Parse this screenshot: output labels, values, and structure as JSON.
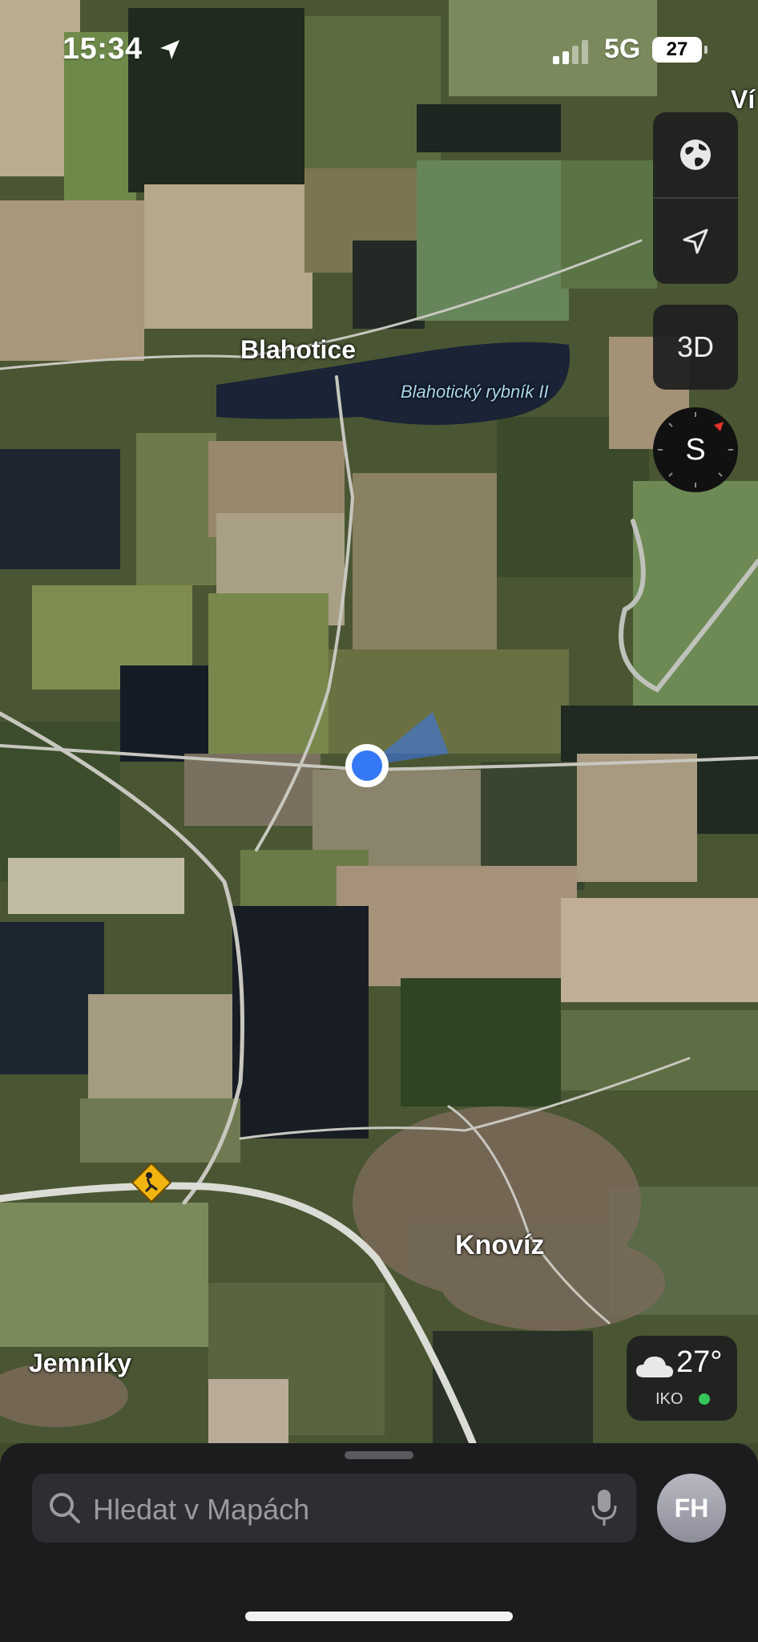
{
  "status_bar": {
    "time": "15:34",
    "network": "5G",
    "battery": "27",
    "icons": [
      "location-arrow-icon",
      "signal-icon",
      "battery-icon"
    ]
  },
  "map": {
    "style": "satellite",
    "labels": {
      "village_top": "Blahotice",
      "lake": "Blahotický rybník II",
      "village_center": "Knovíz",
      "village_left": "Jemníky",
      "edge_cut": "Ví"
    },
    "icons": [
      "construction-warning-icon",
      "user-location-dot"
    ]
  },
  "controls": {
    "globe_icon": "globe-icon",
    "locate_icon": "location-arrow-icon",
    "three_d_label": "3D",
    "compass_letter": "S"
  },
  "weather": {
    "temperature": "27°",
    "air_quality_label": "IKO",
    "icon": "cloud-icon",
    "status_color": "#34c759"
  },
  "search": {
    "placeholder": "Hledat v Mapách",
    "icons": [
      "search-icon",
      "microphone-icon"
    ]
  },
  "profile": {
    "initials": "FH"
  },
  "colors": {
    "panel": "#1e1e20",
    "location_blue": "#3478f6",
    "accent_green": "#34c759"
  }
}
